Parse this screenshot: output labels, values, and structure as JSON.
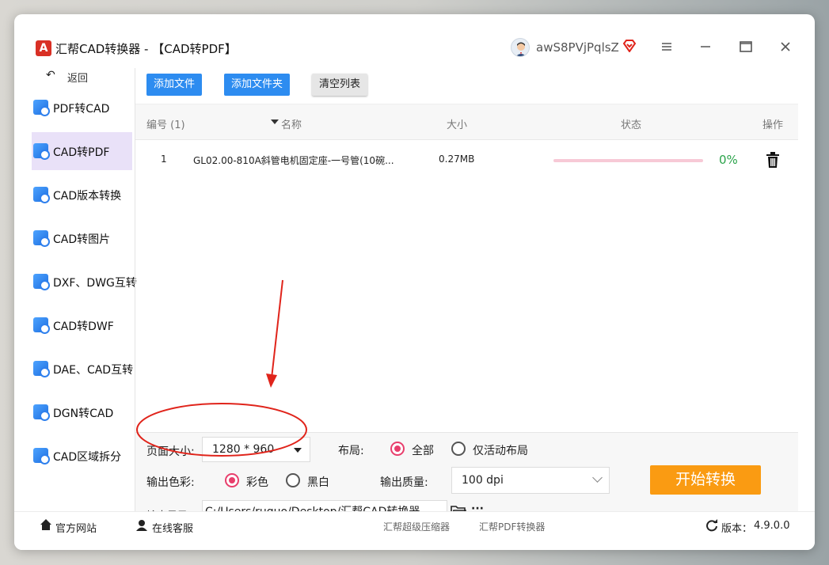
{
  "app": {
    "logo": "A",
    "title": "汇帮CAD转换器 - 【CAD转PDF】",
    "user": "awS8PVjPqlsZ"
  },
  "sidebar": {
    "back": "返回",
    "items": [
      {
        "label": "PDF转CAD",
        "active": false
      },
      {
        "label": "CAD转PDF",
        "active": true
      },
      {
        "label": "CAD版本转换",
        "active": false
      },
      {
        "label": "CAD转图片",
        "active": false
      },
      {
        "label": "DXF、DWG互转",
        "active": false
      },
      {
        "label": "CAD转DWF",
        "active": false
      },
      {
        "label": "DAE、CAD互转",
        "active": false
      },
      {
        "label": "DGN转CAD",
        "active": false
      },
      {
        "label": "CAD区域拆分",
        "active": false
      }
    ]
  },
  "toolbar": {
    "add_file": "添加文件",
    "add_folder": "添加文件夹",
    "clear_list": "清空列表"
  },
  "table": {
    "headers": {
      "index": "编号 (1)",
      "name": "名称",
      "size": "大小",
      "status": "状态",
      "action": "操作"
    },
    "rows": [
      {
        "index": "1",
        "name": "GL02.00-810A斜管电机固定座-一号管(10碗...",
        "size": "0.27MB",
        "progress": 0,
        "progress_text": "0%"
      }
    ]
  },
  "settings": {
    "page_size_label": "页面大小:",
    "page_size_value": "1280 * 960",
    "layout_label": "布局:",
    "layout_all": "全部",
    "layout_active": "仅活动布局",
    "color_label": "输出色彩:",
    "color_color": "彩色",
    "color_bw": "黑白",
    "quality_label": "输出质量:",
    "quality_value": "100 dpi",
    "output_dir_label": "输出目录:",
    "output_dir_value": "C:/Users/ruguo/Desktop/汇帮CAD转换器",
    "more": "···",
    "start_button": "开始转换"
  },
  "footer": {
    "website": "官方网站",
    "service": "在线客服",
    "link1": "汇帮超级压缩器",
    "link2": "汇帮PDF转换器",
    "version_label": "版本：",
    "version": "4.9.0.0"
  },
  "colors": {
    "primary_blue": "#2d8cf0",
    "start_orange": "#fa9b12",
    "radio_pink": "#e83e6c",
    "active_nav": "#e9e1f8",
    "annotation_red": "#e0241b"
  }
}
